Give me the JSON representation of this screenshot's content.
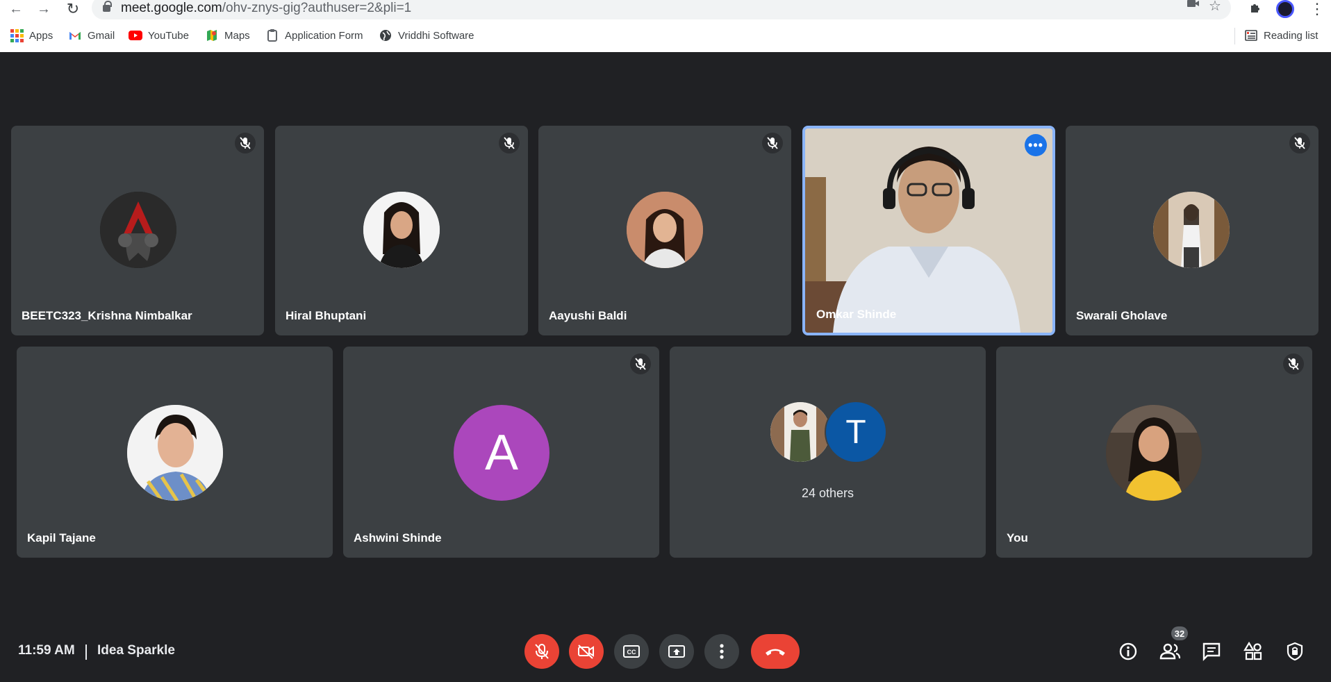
{
  "browser": {
    "url_host": "meet.google.com",
    "url_path": "/ohv-znys-gig?authuser=2&pli=1",
    "bookmarks": [
      {
        "label": "Apps",
        "icon": "apps-grid-icon"
      },
      {
        "label": "Gmail",
        "icon": "gmail-icon"
      },
      {
        "label": "YouTube",
        "icon": "youtube-icon"
      },
      {
        "label": "Maps",
        "icon": "maps-icon"
      },
      {
        "label": "Application Form",
        "icon": "form-icon"
      },
      {
        "label": "Vriddhi Software",
        "icon": "globe-icon"
      }
    ],
    "reading_list": "Reading list"
  },
  "participants_row1": [
    {
      "name": "BEETC323_Krishna Nimbalkar",
      "muted": true,
      "avatar": "assassin-logo"
    },
    {
      "name": "Hiral Bhuptani",
      "muted": true,
      "avatar": "photo"
    },
    {
      "name": "Aayushi Baldi",
      "muted": true,
      "avatar": "photo"
    },
    {
      "name": "Omkar Shinde",
      "muted": false,
      "video": true,
      "active_speaker": true
    },
    {
      "name": "Swarali Gholave",
      "muted": true,
      "avatar": "photo"
    }
  ],
  "participants_row2": [
    {
      "name": "Kapil Tajane",
      "muted": false,
      "avatar": "photo"
    },
    {
      "name": "Ashwini Shinde",
      "muted": true,
      "avatar_letter": "A",
      "avatar_color": "#ab47bc"
    },
    {
      "others_label": "24 others",
      "avatar_letter": "T",
      "avatar_color": "#0b57a4"
    },
    {
      "name": "You",
      "muted": true,
      "avatar": "photo"
    }
  ],
  "meeting": {
    "time": "11:59 AM",
    "separator": "|",
    "name": "Idea Sparkle",
    "participant_count": "32"
  },
  "colors": {
    "background": "#202124",
    "tile": "#3c4043",
    "danger": "#ea4335",
    "active_border": "#8ab4f8",
    "accent": "#1a73e8"
  }
}
